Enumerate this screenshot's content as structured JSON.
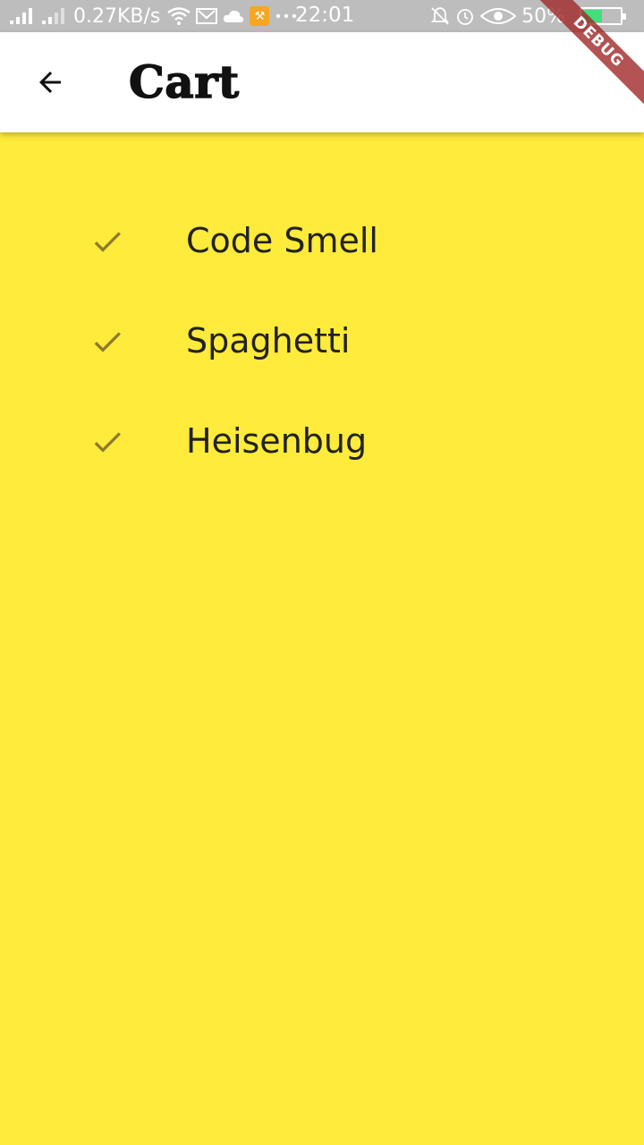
{
  "status_bar": {
    "network_speed": "0.27KB/s",
    "time": "22:01",
    "battery": "50%",
    "battery_level": 0.5
  },
  "app_bar": {
    "title": "Cart",
    "back_icon": "arrow-back-icon"
  },
  "debug_banner": "DEBUG",
  "cart": {
    "items": [
      {
        "label": "Code Smell",
        "icon": "check-icon"
      },
      {
        "label": "Spaghetti",
        "icon": "check-icon"
      },
      {
        "label": "Heisenbug",
        "icon": "check-icon"
      }
    ]
  },
  "colors": {
    "background": "#ffeb3b",
    "check": "#8d7a2a",
    "text": "#222222"
  }
}
